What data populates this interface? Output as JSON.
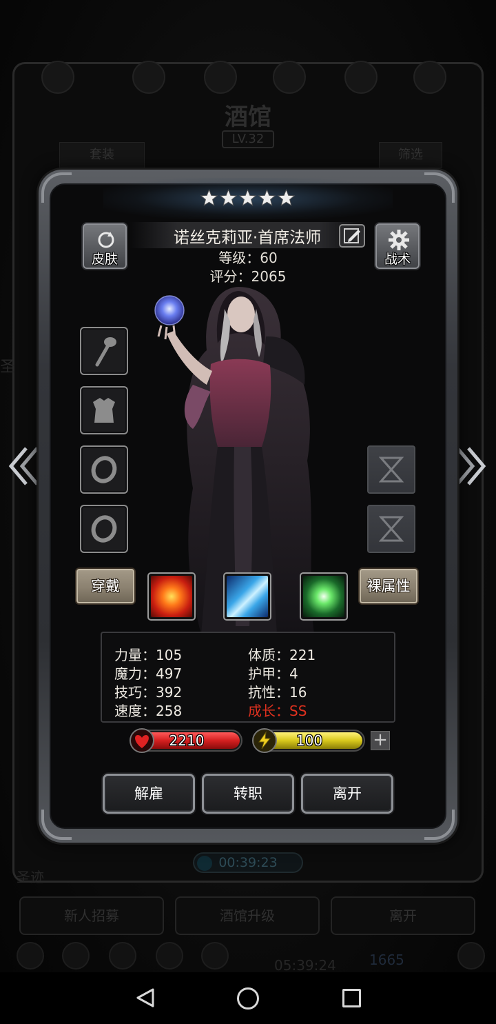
{
  "background_screen": {
    "title": "酒馆",
    "level": "LV.32",
    "tab_left": "套装",
    "tab_right": "筛选",
    "side_text": "圣",
    "timer": "00:39:23",
    "section_label": "圣迹",
    "buttons": [
      "新人招募",
      "酒馆升级",
      "离开"
    ],
    "clock": "05:39:24",
    "gems": "1665"
  },
  "hero": {
    "stars": 5,
    "name": "诺丝克莉亚·首席法师",
    "level_text": "等级：60",
    "score_text": "评分：2065",
    "skin_label": "皮肤",
    "tactics_label": "战术"
  },
  "equipment": {
    "slots": [
      {
        "name": "staff-slot",
        "icon": "staff-icon"
      },
      {
        "name": "armor-slot",
        "icon": "armor-icon"
      },
      {
        "name": "ring-slot-1",
        "icon": "ring-icon"
      },
      {
        "name": "ring-slot-2",
        "icon": "ring-icon"
      }
    ],
    "rune_slots": [
      "rune-slot-1",
      "rune-slot-2"
    ]
  },
  "actions": {
    "wear": "穿戴",
    "base_attributes": "裸属性"
  },
  "skills": [
    {
      "name": "fire-skill",
      "color": "#e8401a"
    },
    {
      "name": "ice-skill",
      "color": "#3aa6e8"
    },
    {
      "name": "nature-skill",
      "color": "#6be86a"
    }
  ],
  "stats": {
    "strength": "力量：105",
    "constitution": "体质：221",
    "magic": "魔力：497",
    "armor": "护甲：4",
    "skill": "技巧：392",
    "resistance": "抗性：16",
    "speed": "速度：258",
    "growth": "成长：SS"
  },
  "bars": {
    "hp": "2210",
    "energy": "100",
    "hp_color": "#d42020",
    "energy_color": "#d8c81c"
  },
  "footer_buttons": {
    "dismiss": "解雇",
    "change_class": "转职",
    "leave": "离开"
  }
}
